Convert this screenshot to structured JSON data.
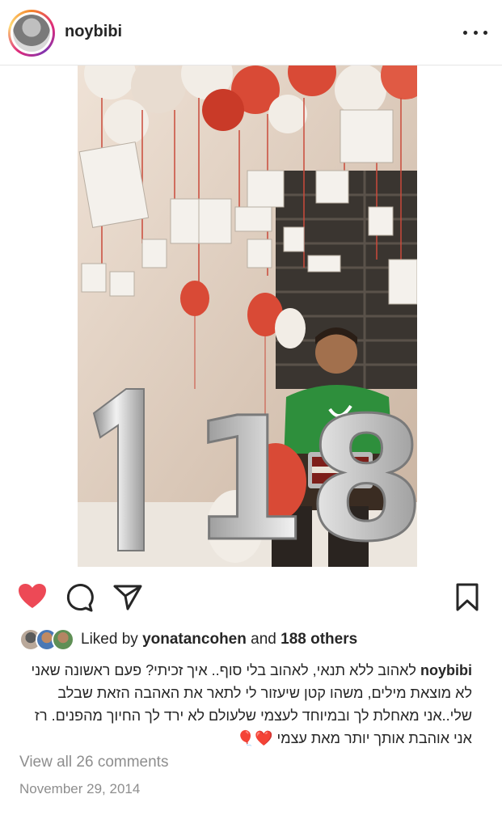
{
  "header": {
    "username": "noybibi",
    "avatar_icon": "profile-photo",
    "more_icon": "more-horizontal-icon"
  },
  "post": {
    "image_description_icon": "photo",
    "image_text": {
      "balloon_number": "18"
    },
    "colors": {
      "wall": "#d9c7b7",
      "balloon_red": "#d94a36",
      "balloon_white": "#f2ede6",
      "shirt": "#2e8f3c"
    }
  },
  "actions": {
    "like_icon": "heart-filled-icon",
    "comment_icon": "comment-icon",
    "share_icon": "send-icon",
    "save_icon": "bookmark-icon",
    "like_color": "#ed4956"
  },
  "likes": {
    "prefix": "Liked by",
    "user": "yonatancohen",
    "middle": "and",
    "others": "188 others"
  },
  "caption": {
    "username": "noybibi",
    "text": "לאהוב ללא תנאי, לאהוב בלי סוף.. איך זכיתי? פעם ראשונה שאני לא מוצאת מילים, משהו קטן שיעזור לי לתאר את האהבה הזאת שבלב שלי..אני מאחלת לך ובמיוחד לעצמי שלעולם לא ירד לך החיוך מהפנים. רז אני אוהבת אותך יותר מאת עצמי ❤️🎈"
  },
  "comments_link": "View all 26 comments",
  "date": "November 29, 2014"
}
